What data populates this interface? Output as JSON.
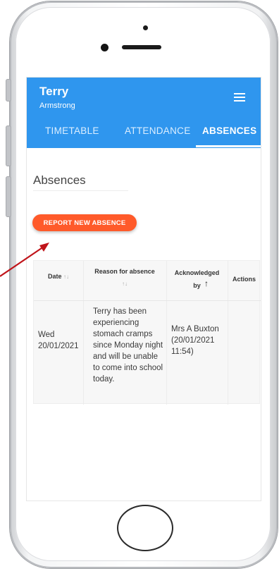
{
  "app": {
    "user_first_name": "Terry",
    "user_last_name": "Armstrong",
    "accent_color": "#2f96ee",
    "button_color": "#ff5a2a"
  },
  "tabs": [
    {
      "label": "TIMETABLE",
      "active": false
    },
    {
      "label": "ATTENDANCE",
      "active": false
    },
    {
      "label": "ABSENCES",
      "active": true
    }
  ],
  "page": {
    "title": "Absences",
    "report_button_label": "REPORT NEW ABSENCE"
  },
  "table": {
    "columns": [
      {
        "label": "Date",
        "sort": "↑↓"
      },
      {
        "label": "Reason for absence",
        "sort": "↑↓"
      },
      {
        "label": "Acknowledged by",
        "sort": "↑"
      },
      {
        "label": "Actions",
        "sort": ""
      }
    ],
    "rows": [
      {
        "date_day": "Wed",
        "date": "20/01/2021",
        "reason": "Terry has been experiencing stomach cramps since Monday night and will be unable to come into school today.",
        "acknowledged_name": "Mrs A Buxton",
        "acknowledged_time": "(20/01/2021 11:54)",
        "actions": ""
      }
    ]
  },
  "icons": {
    "menu": "hamburger-menu-icon",
    "annotation": "red-arrow"
  }
}
